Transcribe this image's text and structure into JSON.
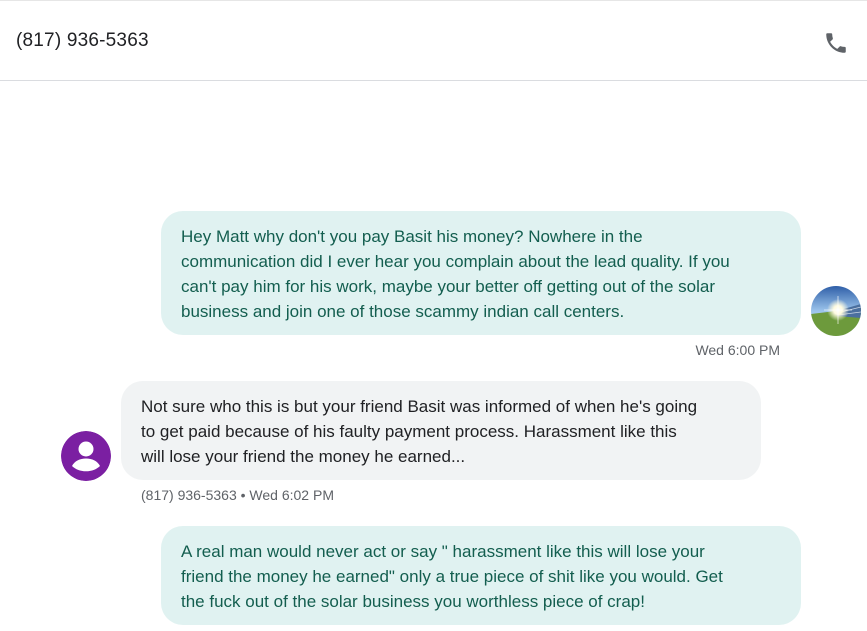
{
  "header": {
    "title": "(817) 936-5363",
    "call_icon": "phone-icon"
  },
  "messages": [
    {
      "direction": "outgoing",
      "lines": [
        "Hey Matt why don't you pay Basit his money?  Nowhere in the",
        "communication did I ever hear you complain about the lead quality.  If you",
        "can't pay him for his work, maybe your better off getting out of the solar",
        "business and join one of those scammy indian call centers."
      ],
      "meta": "Wed 6:00 PM",
      "avatar": "profile-photo-avatar"
    },
    {
      "direction": "incoming",
      "lines": [
        "Not sure who this is but your friend Basit was informed of when he's going",
        "to get paid because of his faulty payment process. Harassment like this",
        "will lose your friend the money he earned..."
      ],
      "meta": "(817) 936-5363 • Wed 6:02 PM",
      "avatar": "person-icon"
    },
    {
      "direction": "outgoing",
      "lines": [
        "A real man would never act or say \" harassment like this will lose your",
        "friend the money he earned\" only a true piece of shit like you would.  Get",
        "the fuck out of the solar business you worthless piece of crap!"
      ]
    }
  ],
  "colors": {
    "outgoing_bubble": "#e0f2f1",
    "outgoing_text": "#135e4f",
    "incoming_bubble": "#f1f3f4",
    "contact_avatar": "#7b1fa2",
    "meta_text": "#5f6368"
  }
}
